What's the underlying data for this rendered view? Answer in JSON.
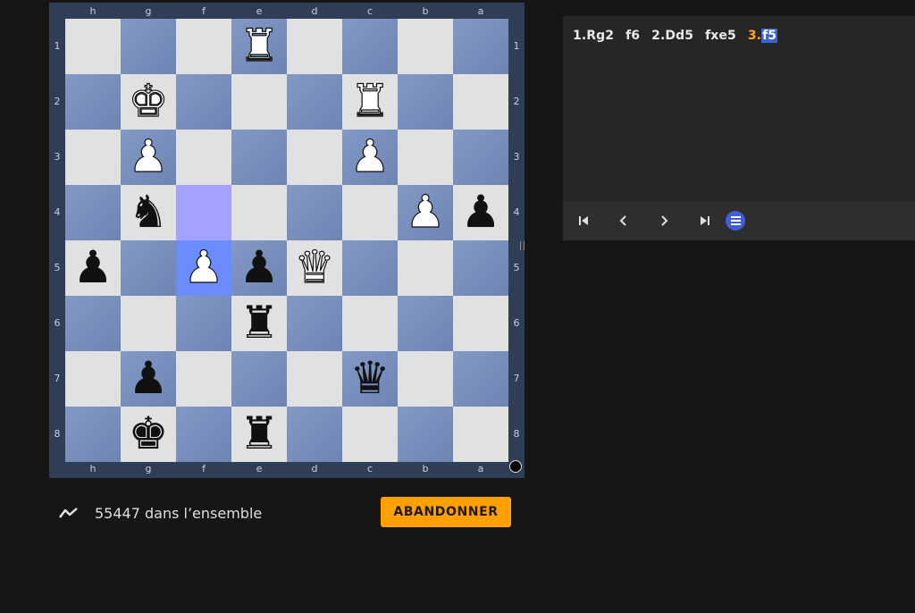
{
  "board": {
    "files": [
      "h",
      "g",
      "f",
      "e",
      "d",
      "c",
      "b",
      "a"
    ],
    "ranks": [
      "1",
      "2",
      "3",
      "4",
      "5",
      "6",
      "7",
      "8"
    ],
    "highlight": {
      "from": "f4",
      "to": "f5"
    },
    "pieces": {
      "e1": "wR",
      "g2": "wK",
      "c2": "wR",
      "g3": "wP",
      "c3": "wP",
      "g4": "bN",
      "b4": "wP",
      "a4": "bP",
      "h5": "bP",
      "f5": "wP",
      "e5": "bP",
      "d5": "wQ",
      "e6": "bR",
      "g7": "bP",
      "c7": "bQ",
      "g8": "bK",
      "e8": "bR"
    },
    "side_to_move": "black"
  },
  "moves": {
    "items": [
      "1.Rg2",
      "f6",
      "2.Dd5",
      "fxe5"
    ],
    "current_number": "3.",
    "current_san": "f5"
  },
  "controls": {
    "first_icon": "first-move-icon",
    "prev_icon": "prev-move-icon",
    "next_icon": "next-move-icon",
    "last_icon": "last-move-icon",
    "menu_icon": "menu-icon"
  },
  "stats": {
    "icon": "activity-line-icon",
    "text": "55447 dans l’ensemble"
  },
  "resign_button": {
    "label": "ABANDONNER"
  },
  "colors": {
    "board_light": "#e1e1e1",
    "board_dark": "#7b90bd",
    "highlight_from": "#a3a3ff",
    "highlight_to": "#6b8cff",
    "accent_orange": "#ff9f00",
    "current_move": "#f5a623",
    "menu_blue": "#3f5fd8"
  }
}
